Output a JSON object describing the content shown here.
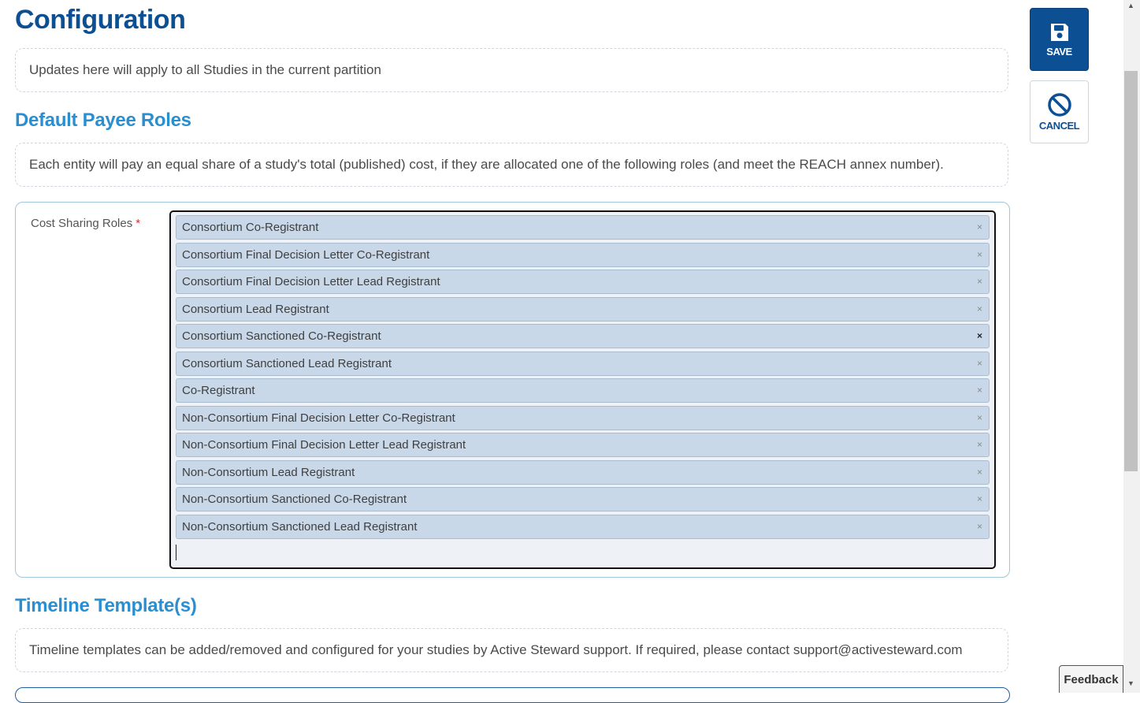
{
  "page": {
    "title": "Configuration",
    "partition_note": "Updates here will apply to all Studies in the current partition"
  },
  "payee_roles": {
    "heading": "Default Payee Roles",
    "description": "Each entity will pay an equal share of a study's total (published) cost, if they are allocated one of the following roles (and meet the REACH annex number).",
    "field_label": "Cost Sharing Roles",
    "required_mark": "*",
    "remove_glyph": "×",
    "selected_roles": [
      "Consortium Co-Registrant",
      "Consortium Final Decision Letter Co-Registrant",
      "Consortium Final Decision Letter Lead Registrant",
      "Consortium Lead Registrant",
      "Consortium Sanctioned Co-Registrant",
      "Consortium Sanctioned Lead Registrant",
      "Co-Registrant",
      "Non-Consortium Final Decision Letter Co-Registrant",
      "Non-Consortium Final Decision Letter Lead Registrant",
      "Non-Consortium Lead Registrant",
      "Non-Consortium Sanctioned Co-Registrant",
      "Non-Consortium Sanctioned Lead Registrant"
    ]
  },
  "timeline": {
    "heading": "Timeline Template(s)",
    "description": "Timeline templates can be added/removed and configured for your studies by Active Steward support. If required, please contact support@activesteward.com"
  },
  "actions": {
    "save_label": "SAVE",
    "cancel_label": "CANCEL",
    "save_icon": "floppy-disk-icon",
    "cancel_icon": "ban-icon"
  },
  "feedback_label": "Feedback",
  "colors": {
    "primary": "#0d4f93",
    "section_heading": "#2a8fd0",
    "tag_bg": "#c8d8e8",
    "required": "#d62f2f"
  }
}
